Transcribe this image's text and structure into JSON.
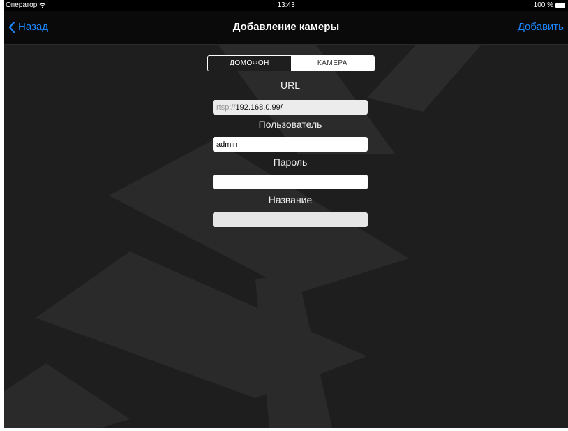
{
  "status_bar": {
    "carrier": "Оператор",
    "time": "13:43",
    "battery": "100 %"
  },
  "nav": {
    "back_label": "Назад",
    "title": "Добавление камеры",
    "add_label": "Добавить"
  },
  "segment": {
    "options": [
      "ДОМОФОН",
      "КАМЕРА"
    ],
    "selected": "КАМЕРА"
  },
  "form": {
    "url_label": "URL",
    "url_prefix": "rtsp://",
    "url_value": "192.168.0.99/",
    "user_label": "Пользователь",
    "user_value": "admin",
    "password_label": "Пароль",
    "password_value": "",
    "name_label": "Название",
    "name_value": ""
  },
  "icons": {
    "wifi": "wifi-icon",
    "battery": "battery-icon",
    "back": "chevron-left-icon"
  },
  "colors": {
    "accent": "#1a86ff",
    "background": "#1e1e1e"
  }
}
